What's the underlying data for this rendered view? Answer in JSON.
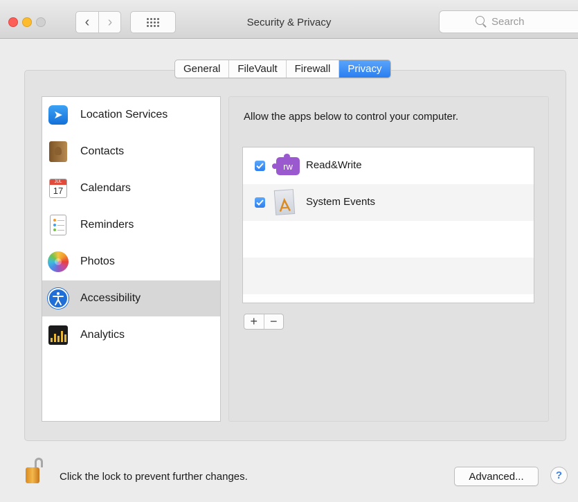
{
  "window": {
    "title": "Security & Privacy"
  },
  "toolbar": {
    "search_placeholder": "Search"
  },
  "tabs": [
    {
      "label": "General",
      "active": false
    },
    {
      "label": "FileVault",
      "active": false
    },
    {
      "label": "Firewall",
      "active": false
    },
    {
      "label": "Privacy",
      "active": true
    }
  ],
  "sidebar": {
    "items": [
      {
        "label": "Location Services",
        "icon": "location-arrow-icon",
        "selected": false
      },
      {
        "label": "Contacts",
        "icon": "contacts-book-icon",
        "selected": false
      },
      {
        "label": "Calendars",
        "icon": "calendar-icon",
        "selected": false
      },
      {
        "label": "Reminders",
        "icon": "reminders-list-icon",
        "selected": false
      },
      {
        "label": "Photos",
        "icon": "photos-flower-icon",
        "selected": false
      },
      {
        "label": "Accessibility",
        "icon": "accessibility-icon",
        "selected": true
      },
      {
        "label": "Analytics",
        "icon": "analytics-bars-icon",
        "selected": false
      }
    ],
    "calendar_icon": {
      "month": "JUL",
      "day": "17"
    }
  },
  "main": {
    "description": "Allow the apps below to control your computer.",
    "apps": [
      {
        "name": "Read&Write",
        "checked": true,
        "icon": "readwrite-puzzle-icon",
        "icon_text": "rw"
      },
      {
        "name": "System Events",
        "checked": true,
        "icon": "system-events-icon"
      }
    ],
    "add_label": "+",
    "remove_label": "−"
  },
  "footer": {
    "lock_text": "Click the lock to prevent further changes.",
    "advanced_label": "Advanced...",
    "help_label": "?"
  },
  "colors": {
    "accent": "#2a7ef0",
    "selected_row": "#d7d7d7",
    "lock_gold": "#f3b84b"
  }
}
